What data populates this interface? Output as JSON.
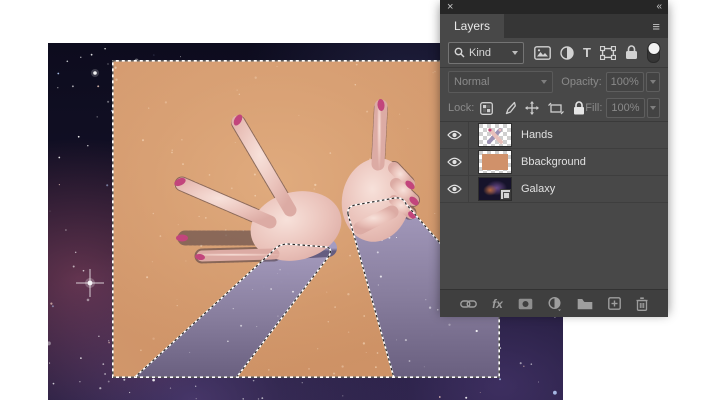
{
  "panel": {
    "header": {
      "close_icon": "×",
      "collapse_icon": "«"
    },
    "tab": {
      "label": "Layers",
      "menu_icon": "≡"
    },
    "filter": {
      "search_label": "Kind",
      "type_letter": "T"
    },
    "blend": {
      "mode": "Normal",
      "opacity_label": "Opacity:",
      "opacity_value": "100%"
    },
    "lock": {
      "label": "Lock:",
      "fill_label": "Fill:",
      "fill_value": "100%"
    },
    "layers": [
      {
        "name": "Hands"
      },
      {
        "name": "Bbackground"
      },
      {
        "name": "Galaxy"
      }
    ],
    "footer": {
      "fx_label": "fx"
    }
  },
  "canvas": {
    "selection_style": "marching-ants",
    "colors": {
      "galaxy_dark": "#0d0c1e",
      "galaxy_purple": "#6c509e",
      "nebula_maroon": "#ac5470",
      "artboard_orange": "#d49a6f",
      "skin": "#eecbc4",
      "nails_pink": "#c2457c",
      "arm_galaxy": "#8b84a6",
      "panel_gray": "#484848",
      "panel_header": "#262626"
    }
  }
}
